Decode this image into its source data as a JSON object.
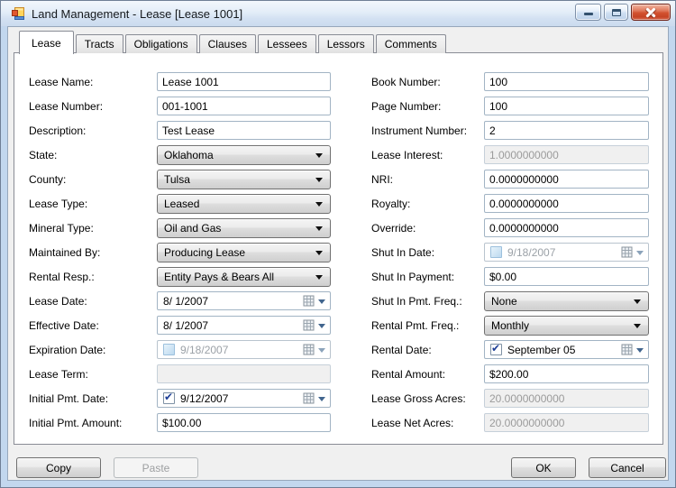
{
  "window": {
    "title": "Land Management - Lease [Lease 1001]",
    "controls": [
      "minimize",
      "maximize",
      "close"
    ]
  },
  "tabs": [
    {
      "label": "Lease",
      "active": true
    },
    {
      "label": "Tracts",
      "active": false
    },
    {
      "label": "Obligations",
      "active": false
    },
    {
      "label": "Clauses",
      "active": false
    },
    {
      "label": "Lessees",
      "active": false
    },
    {
      "label": "Lessors",
      "active": false
    },
    {
      "label": "Comments",
      "active": false
    }
  ],
  "form": {
    "left": [
      {
        "label": "Lease Name:",
        "type": "text",
        "value": "Lease 1001",
        "disabled": false
      },
      {
        "label": "Lease Number:",
        "type": "text",
        "value": "001-1001",
        "disabled": false
      },
      {
        "label": "Description:",
        "type": "text",
        "value": "Test Lease",
        "disabled": false
      },
      {
        "label": "State:",
        "type": "combo",
        "value": "Oklahoma",
        "disabled": false
      },
      {
        "label": "County:",
        "type": "combo",
        "value": "Tulsa",
        "disabled": false
      },
      {
        "label": "Lease Type:",
        "type": "combo",
        "value": "Leased",
        "disabled": false
      },
      {
        "label": "Mineral Type:",
        "type": "combo",
        "value": "Oil and Gas",
        "disabled": false
      },
      {
        "label": "Maintained By:",
        "type": "combo",
        "value": "Producing Lease",
        "disabled": false
      },
      {
        "label": "Rental Resp.:",
        "type": "combo",
        "value": "Entity Pays & Bears All",
        "disabled": false
      },
      {
        "label": "Lease Date:",
        "type": "date",
        "value": "8/ 1/2007",
        "disabled": false
      },
      {
        "label": "Effective Date:",
        "type": "date",
        "value": "8/ 1/2007",
        "disabled": false
      },
      {
        "label": "Expiration Date:",
        "type": "date-check",
        "value": "9/18/2007",
        "checked": false,
        "disabled": true
      },
      {
        "label": "Lease Term:",
        "type": "text",
        "value": "",
        "disabled": true
      },
      {
        "label": "Initial Pmt. Date:",
        "type": "date-check",
        "value": "9/12/2007",
        "checked": true,
        "disabled": false
      },
      {
        "label": "Initial Pmt. Amount:",
        "type": "text",
        "value": "$100.00",
        "disabled": false
      }
    ],
    "right": [
      {
        "label": "Book Number:",
        "type": "text",
        "value": "100",
        "disabled": false
      },
      {
        "label": "Page Number:",
        "type": "text",
        "value": "100",
        "disabled": false
      },
      {
        "label": "Instrument Number:",
        "type": "text",
        "value": "2",
        "disabled": false
      },
      {
        "label": "Lease Interest:",
        "type": "text",
        "value": "1.0000000000",
        "disabled": true
      },
      {
        "label": "NRI:",
        "type": "text",
        "value": "0.0000000000",
        "disabled": false
      },
      {
        "label": "Royalty:",
        "type": "text",
        "value": "0.0000000000",
        "disabled": false
      },
      {
        "label": "Override:",
        "type": "text",
        "value": "0.0000000000",
        "disabled": false
      },
      {
        "label": "Shut In Date:",
        "type": "date-check",
        "value": "9/18/2007",
        "checked": false,
        "disabled": true
      },
      {
        "label": "Shut In Payment:",
        "type": "text",
        "value": "$0.00",
        "disabled": false
      },
      {
        "label": "Shut In Pmt. Freq.:",
        "type": "combo",
        "value": "None",
        "disabled": false
      },
      {
        "label": "Rental Pmt. Freq.:",
        "type": "combo",
        "value": "Monthly",
        "disabled": false
      },
      {
        "label": "Rental Date:",
        "type": "date-check",
        "value": "September 05",
        "checked": true,
        "disabled": false
      },
      {
        "label": "Rental Amount:",
        "type": "text",
        "value": "$200.00",
        "disabled": false
      },
      {
        "label": "Lease Gross Acres:",
        "type": "text",
        "value": "20.0000000000",
        "disabled": true
      },
      {
        "label": "Lease Net Acres:",
        "type": "text",
        "value": "20.0000000000",
        "disabled": true
      }
    ]
  },
  "buttons": {
    "copy": "Copy",
    "paste": "Paste",
    "ok": "OK",
    "cancel": "Cancel"
  },
  "colors": {
    "window_frame": "#c2d7ee",
    "client_bg": "#f0f0f0",
    "tabpage_bg": "#ffffff",
    "close_button": "#d2512f",
    "check_mark": "#1e3f97",
    "disabled_text": "#9b9b9b",
    "textbox_border": "#a2b4c4"
  }
}
